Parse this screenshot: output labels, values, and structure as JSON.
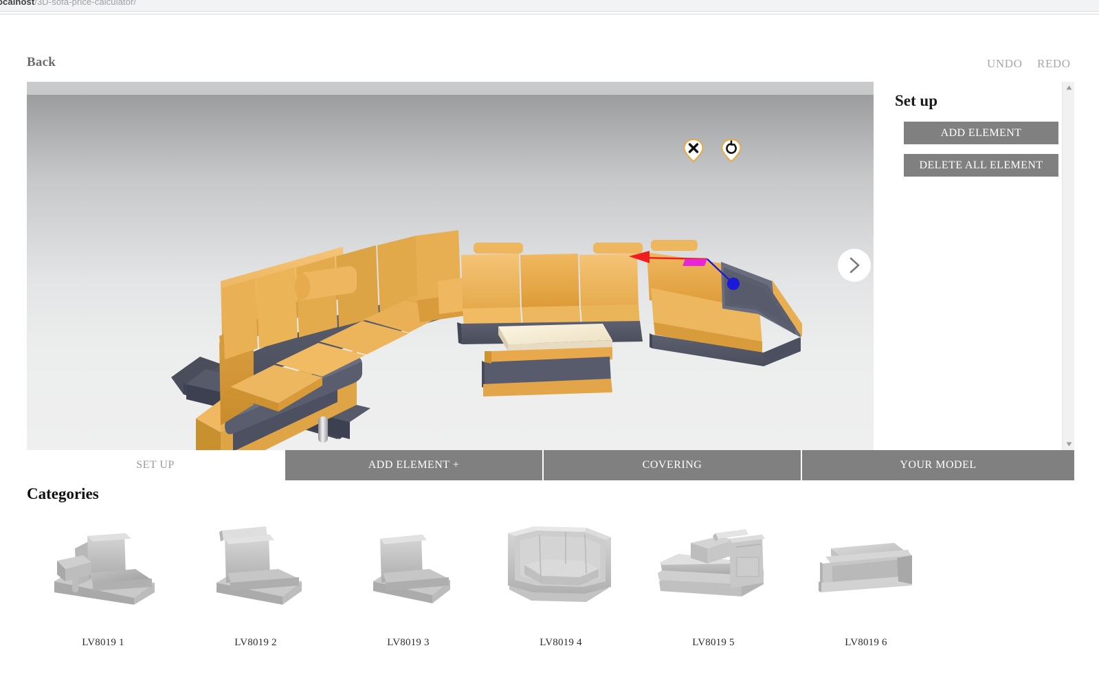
{
  "browser": {
    "url_host": "ocalhost",
    "url_path": "/3D-sofa-price-calculator/"
  },
  "header": {
    "back_label": "Back",
    "undo_label": "UNDO",
    "redo_label": "REDO"
  },
  "viewport": {
    "delete_icon": "close-x-icon",
    "rotate_icon": "rotate-ccw-icon",
    "next_icon": "chevron-right-icon",
    "gizmo": {
      "x_axis_color": "#f01e1e",
      "z_axis_color": "#1a1ad6",
      "plane_color": "#e626d8"
    },
    "model_colors": {
      "cushion": "#e8a94a",
      "cushion_light": "#f0bb63",
      "base": "#555866",
      "table_top": "#f5ecd6"
    }
  },
  "side_panel": {
    "title": "Set up",
    "add_element_label": "ADD ELEMENT",
    "delete_all_label": "DELETE ALL ELEMENT",
    "button_color": "#808080",
    "scroll_up_icon": "triangle-up-icon",
    "scroll_down_icon": "triangle-down-icon"
  },
  "tabs": [
    {
      "label": "SET UP",
      "active": true
    },
    {
      "label": "ADD ELEMENT +",
      "active": false
    },
    {
      "label": "COVERING",
      "active": false
    },
    {
      "label": "YOUR MODEL",
      "active": false
    }
  ],
  "categories": {
    "title": "Categories",
    "items": [
      {
        "label": "LV8019 1",
        "thumb": "armchair-left-arm-module"
      },
      {
        "label": "LV8019 2",
        "thumb": "armless-chair-headrest-module"
      },
      {
        "label": "LV8019 3",
        "thumb": "armless-chair-module"
      },
      {
        "label": "LV8019 4",
        "thumb": "corner-wedge-module"
      },
      {
        "label": "LV8019 5",
        "thumb": "chaise-lounge-module"
      },
      {
        "label": "LV8019 6",
        "thumb": "ottoman-table-module"
      }
    ]
  }
}
